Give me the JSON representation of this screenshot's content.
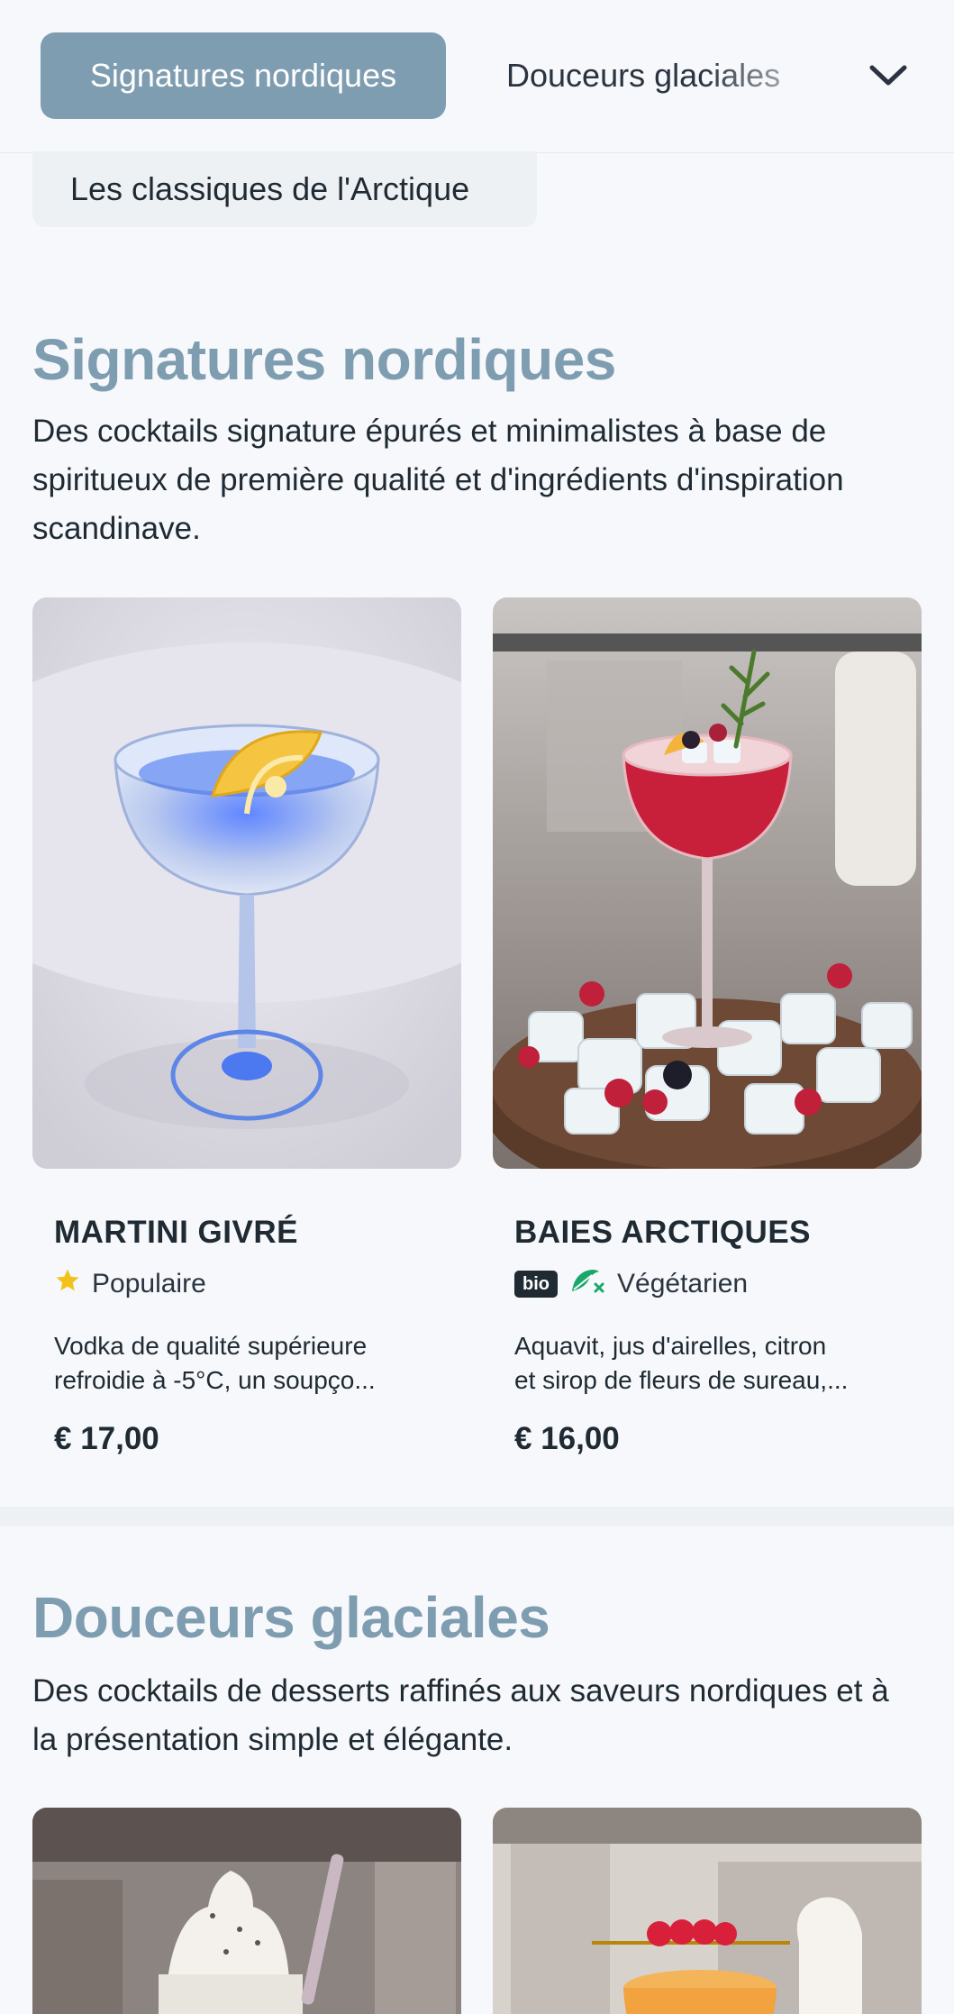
{
  "categories": {
    "active": "Signatures nordiques",
    "next": "Douceurs glaciales",
    "row2": "Les classiques de l'Arctique"
  },
  "sections": [
    {
      "title": "Signatures nordiques",
      "description": "Des cocktails signature épurés et minimalistes à base de spiritueux de première qualité et d'ingrédients d'inspiration scandinave.",
      "items": [
        {
          "name": "MARTINI GIVRÉ",
          "tag": "Populaire",
          "description_line1": "Vodka de qualité supérieure",
          "description_line2": "refroidie à -5°C, un soupço...",
          "price": "€ 17,00"
        },
        {
          "name": "BAIES ARCTIQUES",
          "badge": "bio",
          "tag": "Végétarien",
          "description_line1": "Aquavit, jus d'airelles, citron",
          "description_line2": "et sirop de fleurs de sureau,...",
          "price": "€ 16,00"
        }
      ]
    },
    {
      "title": "Douceurs glaciales",
      "description": "Des cocktails de desserts raffinés aux saveurs nordiques et à la présentation simple et élégante."
    }
  ],
  "colors": {
    "accent": "#7f9db0",
    "text": "#1f2a33",
    "star": "#f2c21a",
    "vegetarian": "#1aa86a"
  }
}
